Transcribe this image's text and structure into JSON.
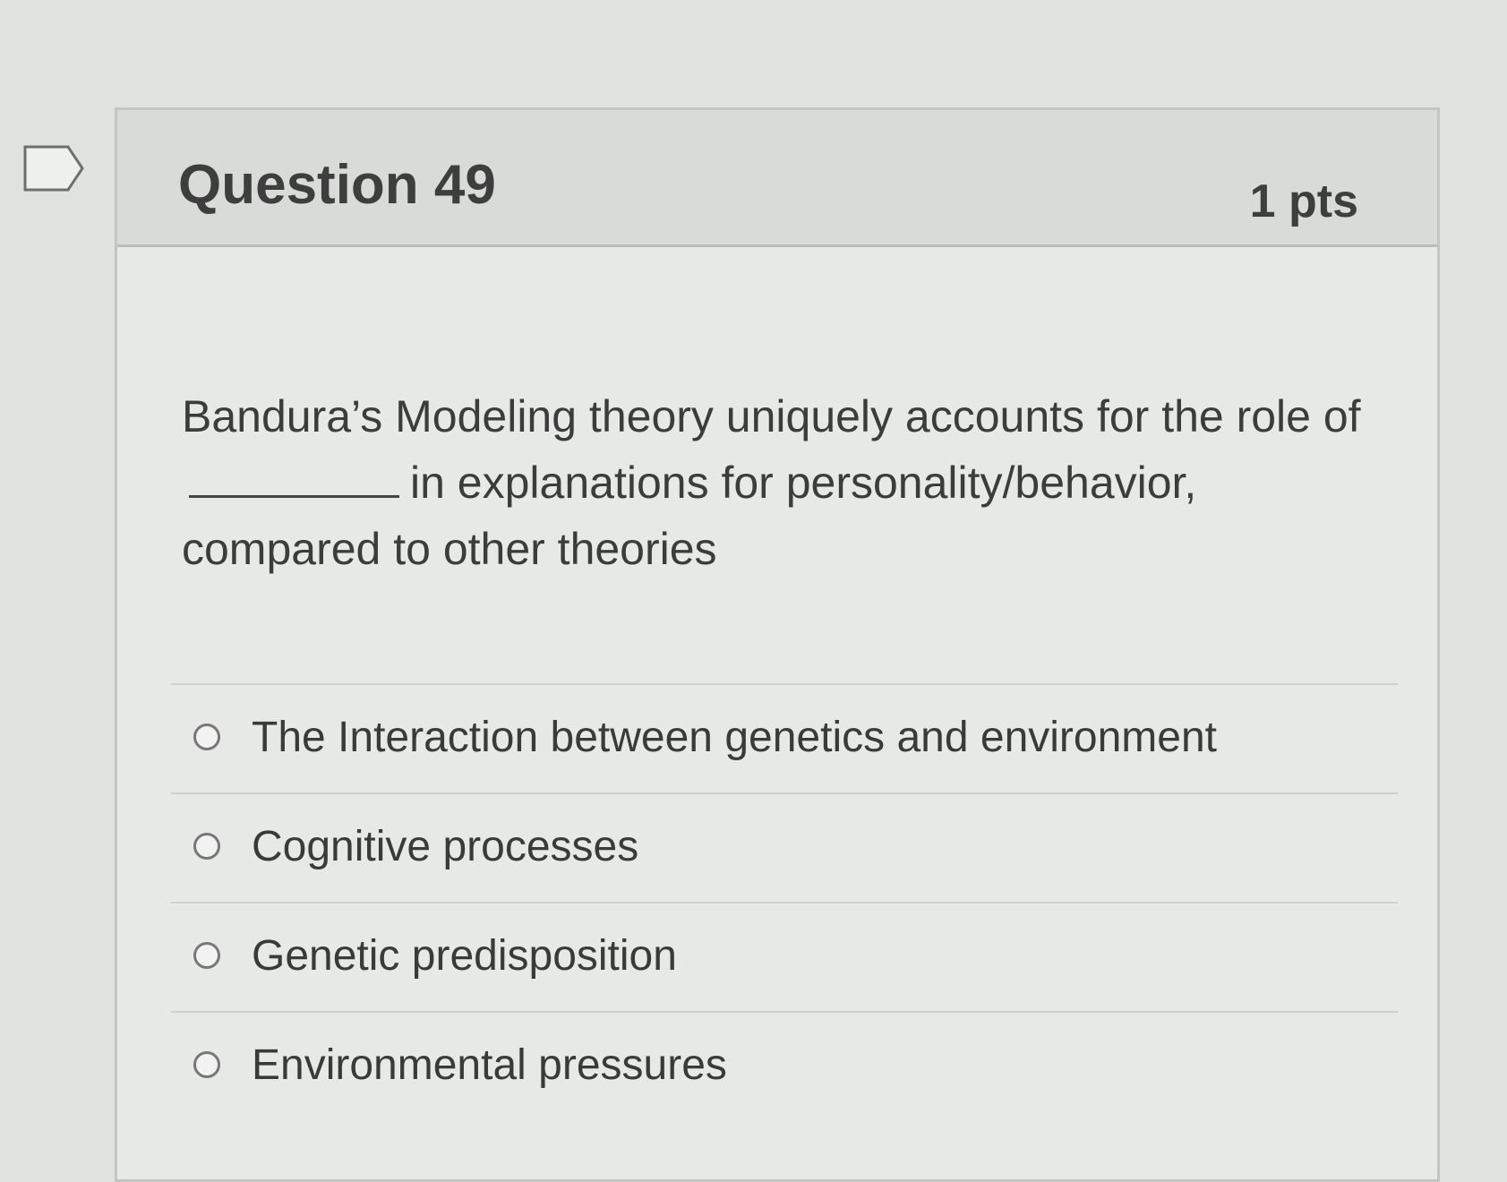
{
  "question": {
    "title": "Question 49",
    "points": "1 pts",
    "text_part1": "Bandura’s Modeling theory uniquely accounts for the role of",
    "text_part2": "in explanations for personality/behavior, compared to other theories"
  },
  "answers": [
    {
      "label": "The Interaction between genetics and environment"
    },
    {
      "label": "Cognitive processes"
    },
    {
      "label": "Genetic predisposition"
    },
    {
      "label": "Environmental pressures"
    }
  ],
  "icons": {
    "flag": "bookmark-flag-icon",
    "radio": "radio-button-icon"
  },
  "colors": {
    "header_bg": "#d8dbd8",
    "text": "#3c3c3c"
  }
}
